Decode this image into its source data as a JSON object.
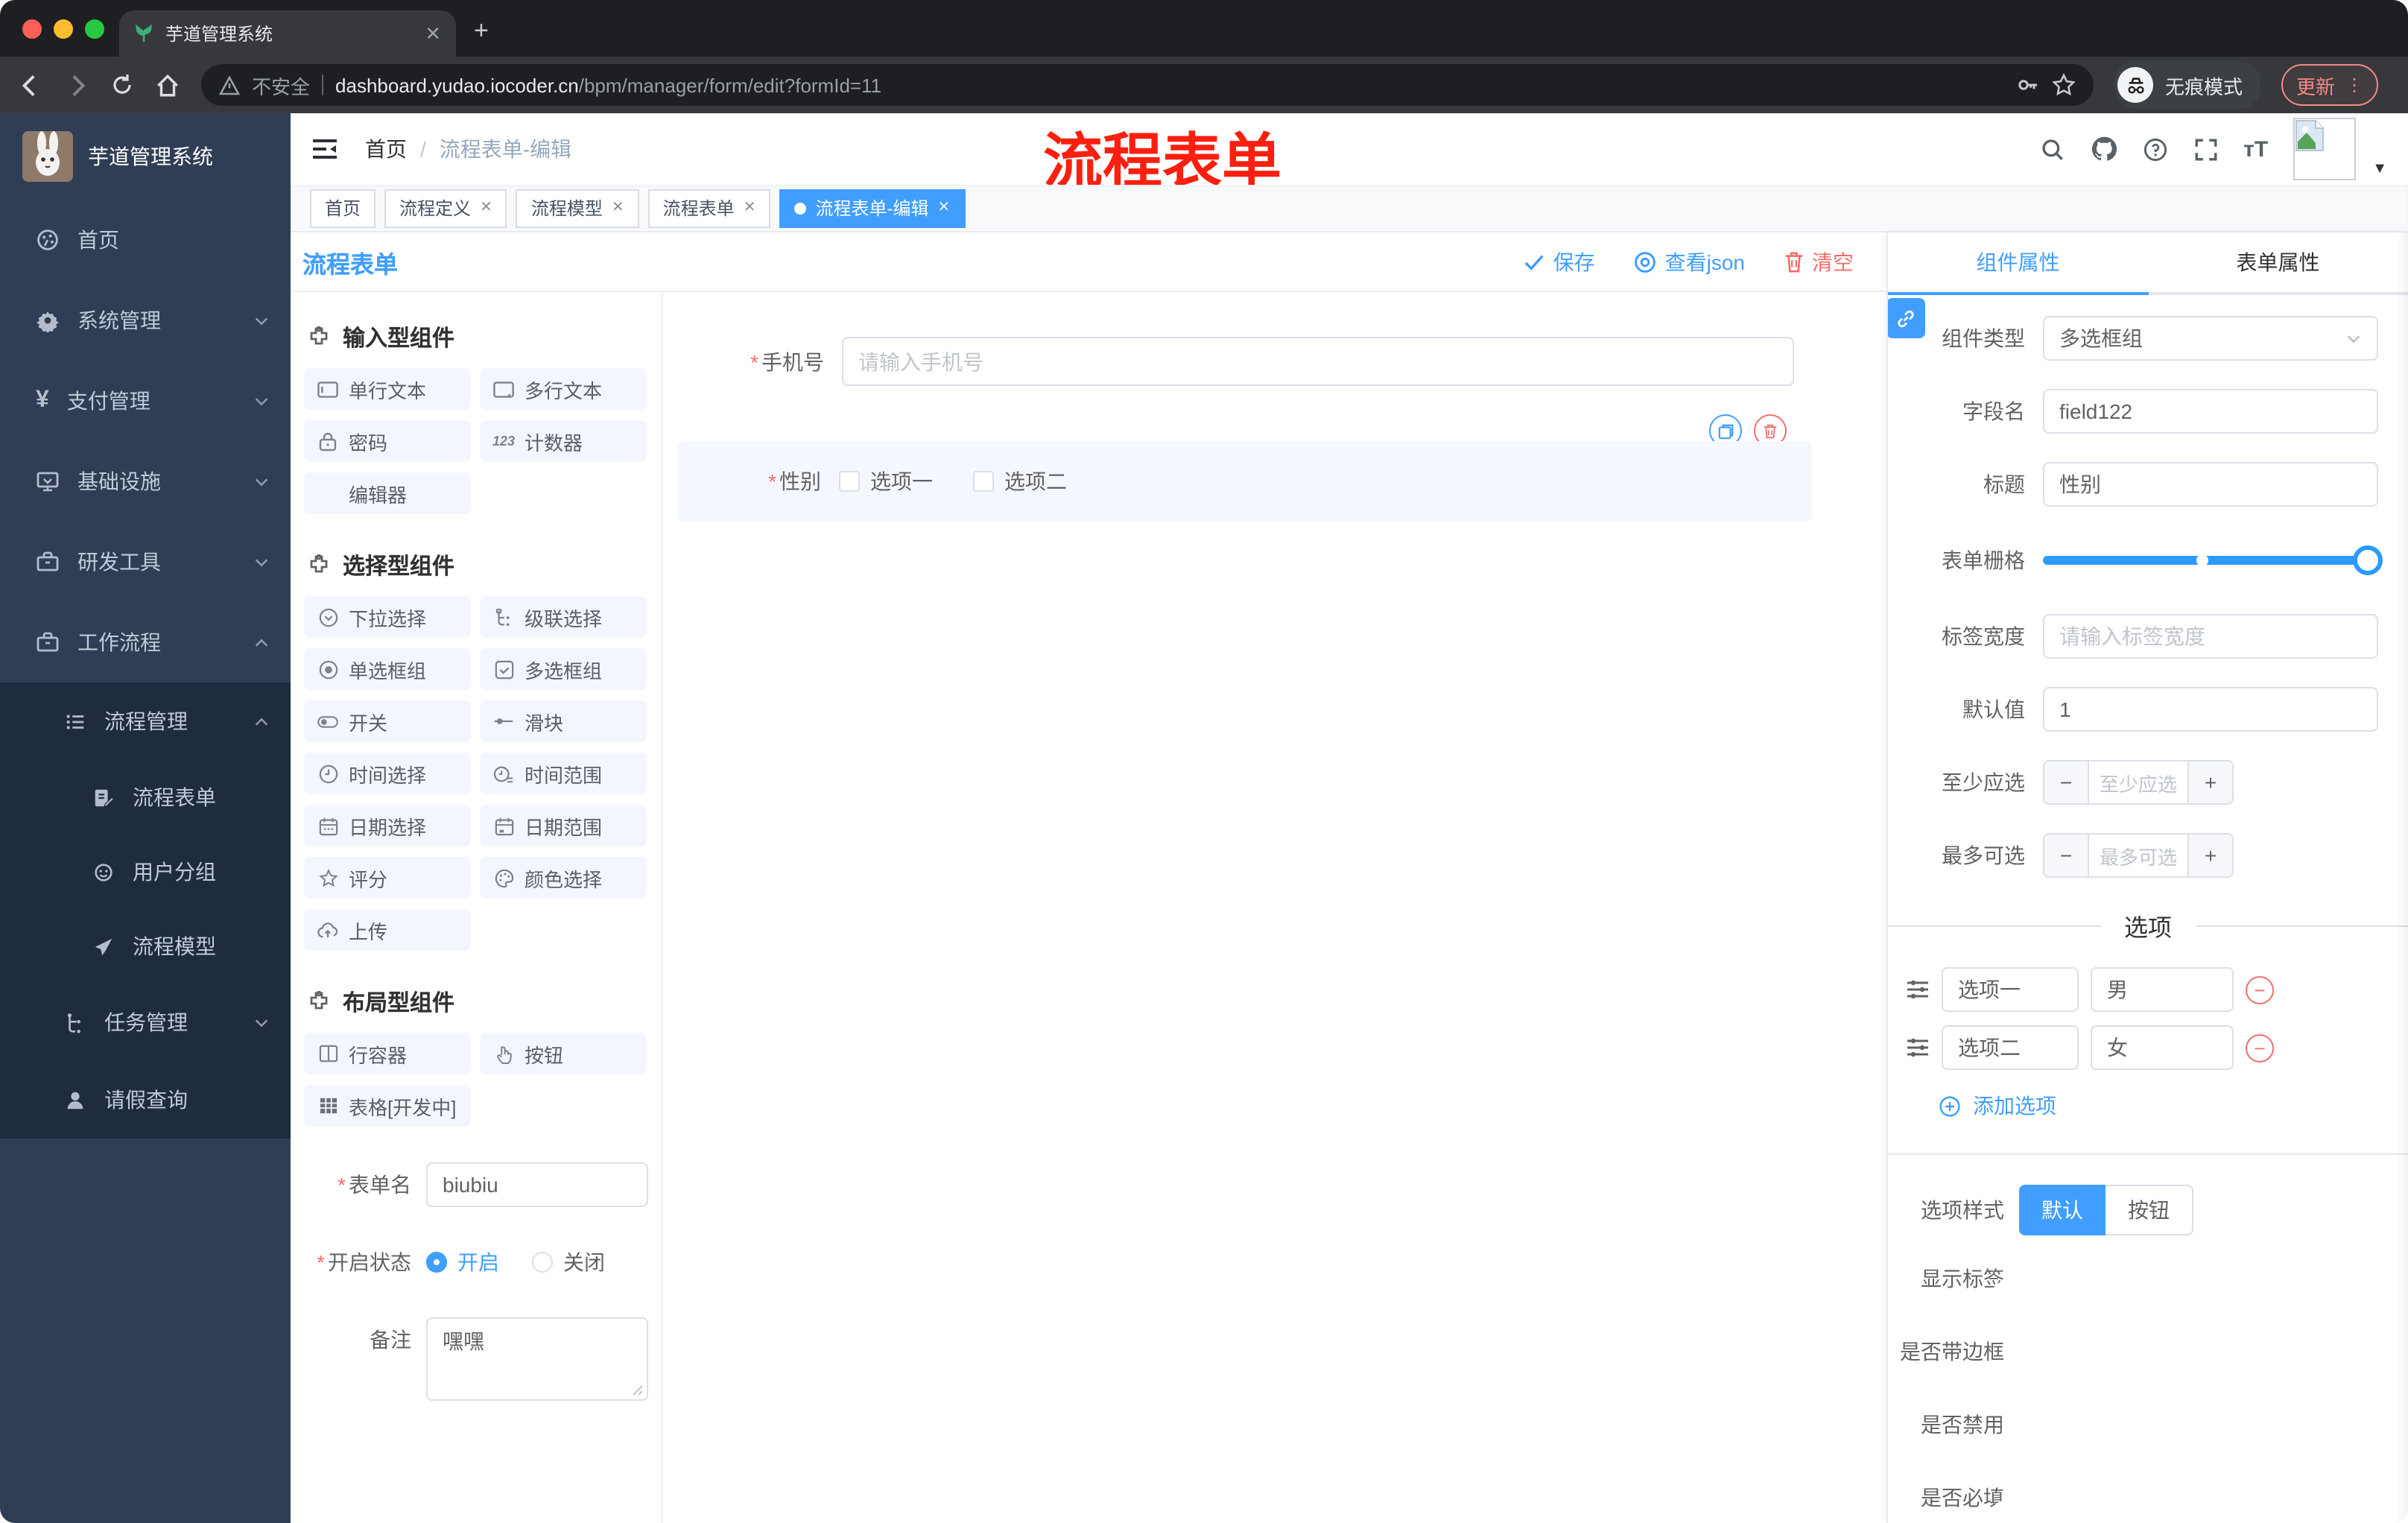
{
  "browser": {
    "tab_title": "芋道管理系统",
    "close_glyph": "✕",
    "security_label": "不安全",
    "url_domain": "dashboard.yudao.iocoder.cn",
    "url_path": "/bpm/manager/form/edit?formId=11",
    "incognito_label": "无痕模式",
    "update_label": "更新",
    "menu_dots": "⋮"
  },
  "sidebar": {
    "app_title": "芋道管理系统",
    "menu": {
      "home": "首页",
      "system": "系统管理",
      "payment": "支付管理",
      "infrastructure": "基础设施",
      "devtools": "研发工具",
      "workflow": "工作流程",
      "process_mgmt": "流程管理",
      "process_form": "流程表单",
      "user_group": "用户分组",
      "process_model": "流程模型",
      "task_mgmt": "任务管理",
      "leave_query": "请假查询"
    }
  },
  "header": {
    "breadcrumb_home": "首页",
    "breadcrumb_sep": "/",
    "breadcrumb_current": "流程表单-编辑",
    "annotation": "流程表单"
  },
  "tabs": {
    "t1": "首页",
    "t2": "流程定义",
    "t3": "流程模型",
    "t4": "流程表单",
    "t5": "流程表单-编辑"
  },
  "toolbar": {
    "title": "流程表单",
    "save": "保存",
    "view_json": "查看json",
    "clear": "清空"
  },
  "palette": {
    "section_input": "输入型组件",
    "single_text": "单行文本",
    "multi_text": "多行文本",
    "password": "密码",
    "counter": "计数器",
    "editor": "编辑器",
    "section_select": "选择型组件",
    "select": "下拉选择",
    "cascader": "级联选择",
    "radio_group": "单选框组",
    "checkbox_group": "多选框组",
    "switch": "开关",
    "slider": "滑块",
    "time": "时间选择",
    "time_range": "时间范围",
    "date": "日期选择",
    "date_range": "日期范围",
    "rate": "评分",
    "color": "颜色选择",
    "upload": "上传",
    "section_layout": "布局型组件",
    "row_container": "行容器",
    "button": "按钮",
    "table_dev": "表格[开发中]"
  },
  "meta_form": {
    "name_label": "表单名",
    "name_value": "biubiu",
    "status_label": "开启状态",
    "status_on": "开启",
    "status_off": "关闭",
    "remark_label": "备注",
    "remark_value": "嘿嘿"
  },
  "canvas": {
    "phone_label": "手机号",
    "phone_placeholder": "请输入手机号",
    "gender_label": "性别",
    "gender_opt1": "选项一",
    "gender_opt2": "选项二"
  },
  "panel": {
    "tab_component": "组件属性",
    "tab_form": "表单属性",
    "type_label": "组件类型",
    "type_value": "多选框组",
    "field_label": "字段名",
    "field_value": "field122",
    "title_label": "标题",
    "title_value": "性别",
    "grid_label": "表单栅格",
    "label_width_label": "标签宽度",
    "label_width_placeholder": "请输入标签宽度",
    "default_label": "默认值",
    "default_value": "1",
    "min_label": "至少应选",
    "min_placeholder": "至少应选",
    "max_label": "最多可选",
    "max_placeholder": "最多可选",
    "options_title": "选项",
    "opt1_label": "选项一",
    "opt1_value": "男",
    "opt2_label": "选项二",
    "opt2_value": "女",
    "add_option": "添加选项",
    "style_label": "选项样式",
    "style_default": "默认",
    "style_button": "按钮",
    "show_label_label": "显示标签",
    "border_label": "是否带边框",
    "disabled_label": "是否禁用",
    "required_label": "是否必填"
  },
  "colors": {
    "accent": "#409eff",
    "danger": "#f56c6c",
    "annotation_red": "#fb1f0f",
    "sidebar_bg": "#2f3e54",
    "submenu_bg": "#1f2c40"
  }
}
